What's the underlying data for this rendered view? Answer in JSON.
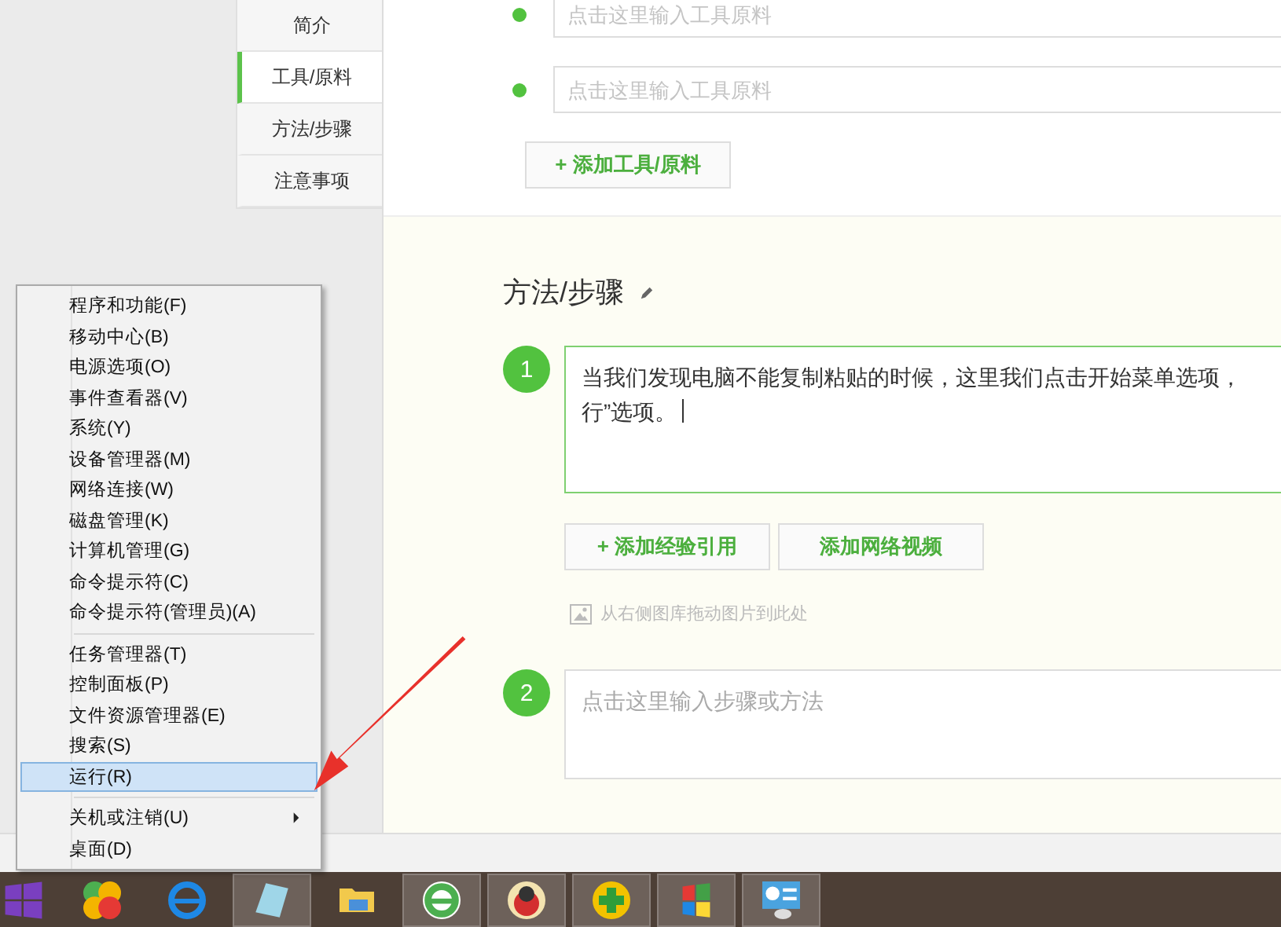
{
  "nav": {
    "items": [
      {
        "label": "简介",
        "selected": false
      },
      {
        "label": "工具/原料",
        "selected": true
      },
      {
        "label": "方法/步骤",
        "selected": false
      },
      {
        "label": "注意事项",
        "selected": false
      }
    ]
  },
  "tools": {
    "inputs": [
      {
        "placeholder": "点击这里输入工具原料"
      },
      {
        "placeholder": "点击这里输入工具原料"
      }
    ],
    "add_button": "+ 添加工具/原料"
  },
  "steps_section": {
    "title": "方法/步骤",
    "steps": [
      {
        "number": "1",
        "value_lines": [
          "当我们发现电脑不能复制粘贴的时候，这里我们点击开始菜单选项，",
          "行”选项。"
        ],
        "focused": true,
        "buttons": [
          "+ 添加经验引用",
          "添加网络视频"
        ],
        "image_hint": "从右侧图库拖动图片到此处"
      },
      {
        "number": "2",
        "placeholder": "点击这里输入步骤或方法",
        "focused": false
      }
    ]
  },
  "context_menu": {
    "groups": [
      [
        {
          "label": "程序和功能(F)",
          "selected": false
        },
        {
          "label": "移动中心(B)",
          "selected": false
        },
        {
          "label": "电源选项(O)",
          "selected": false
        },
        {
          "label": "事件查看器(V)",
          "selected": false
        },
        {
          "label": "系统(Y)",
          "selected": false
        },
        {
          "label": "设备管理器(M)",
          "selected": false
        },
        {
          "label": "网络连接(W)",
          "selected": false
        },
        {
          "label": "磁盘管理(K)",
          "selected": false
        },
        {
          "label": "计算机管理(G)",
          "selected": false
        },
        {
          "label": "命令提示符(C)",
          "selected": false
        },
        {
          "label": "命令提示符(管理员)(A)",
          "selected": false
        }
      ],
      [
        {
          "label": "任务管理器(T)",
          "selected": false
        },
        {
          "label": "控制面板(P)",
          "selected": false
        },
        {
          "label": "文件资源管理器(E)",
          "selected": false
        },
        {
          "label": "搜索(S)",
          "selected": false
        },
        {
          "label": "运行(R)",
          "selected": true
        }
      ],
      [
        {
          "label": "关机或注销(U)",
          "selected": false,
          "submenu": true
        },
        {
          "label": "桌面(D)",
          "selected": false
        }
      ]
    ]
  },
  "taskbar": {
    "apps": [
      {
        "kind": "balls",
        "active": false
      },
      {
        "kind": "ie",
        "active": false
      },
      {
        "kind": "notes",
        "active": true
      },
      {
        "kind": "folder",
        "active": false
      },
      {
        "kind": "green-e",
        "active": true
      },
      {
        "kind": "bird",
        "active": true
      },
      {
        "kind": "plus",
        "active": true
      },
      {
        "kind": "flag",
        "active": true
      },
      {
        "kind": "panel",
        "active": true
      }
    ]
  }
}
